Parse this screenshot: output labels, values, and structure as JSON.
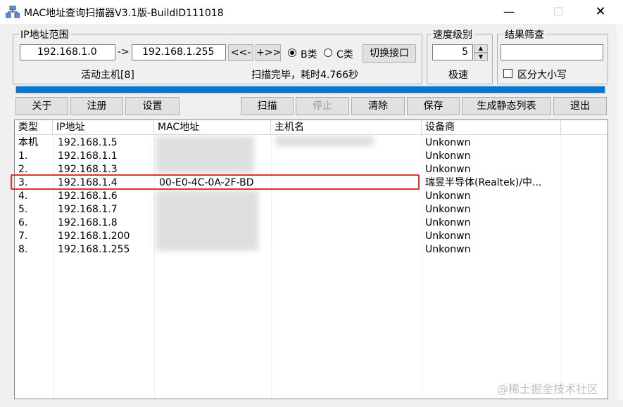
{
  "window": {
    "title": "MAC地址查询扫描器V3.1版-BuildID111018",
    "minimize": "—",
    "maximize": "☐",
    "close": "✕"
  },
  "ip_range": {
    "label": "IP地址范围",
    "start_ip": "192.168.1.0",
    "arrow": "->",
    "end_ip": "192.168.1.255",
    "prev_btn": "<<-",
    "next_btn": "+>>",
    "class_b": "B类",
    "class_c": "C类",
    "class_b_selected": true,
    "switch_btn": "切换接口",
    "active_hosts": "活动主机[8]",
    "scan_status": "扫描完毕，耗时4.766秒"
  },
  "speed": {
    "label": "速度级别",
    "value": "5",
    "level": "极速"
  },
  "filter": {
    "label": "结果筛查",
    "input_value": "",
    "case_label": "区分大小写",
    "case_checked": false
  },
  "progress": 1.0,
  "toolbar": {
    "about": "关于",
    "register": "注册",
    "settings": "设置",
    "scan": "扫描",
    "stop": "停止",
    "clear": "清除",
    "save": "保存",
    "gen_static": "生成静态列表",
    "exit": "退出"
  },
  "table": {
    "columns": [
      "类型",
      "IP地址",
      "MAC地址",
      "主机名",
      "设备商"
    ],
    "rows": [
      {
        "type": "本机",
        "ip": "192.168.1.5",
        "mac": "",
        "host": "",
        "vendor": "Unkonwn"
      },
      {
        "type": "1.",
        "ip": "192.168.1.1",
        "mac": "",
        "host": "",
        "vendor": "Unkonwn"
      },
      {
        "type": "2.",
        "ip": "192.168.1.3",
        "mac": "",
        "host": "",
        "vendor": "Unkonwn"
      },
      {
        "type": "3.",
        "ip": "192.168.1.4",
        "mac": "00-E0-4C-0A-2F-BD",
        "host": "",
        "vendor": "瑞昱半导体(Realtek)/中..."
      },
      {
        "type": "4.",
        "ip": "192.168.1.6",
        "mac": "",
        "host": "",
        "vendor": "Unkonwn"
      },
      {
        "type": "5.",
        "ip": "192.168.1.7",
        "mac": "",
        "host": "",
        "vendor": "Unkonwn"
      },
      {
        "type": "6.",
        "ip": "192.168.1.8",
        "mac": "",
        "host": "",
        "vendor": "Unkonwn"
      },
      {
        "type": "7.",
        "ip": "192.168.1.200",
        "mac": "",
        "host": "",
        "vendor": "Unkonwn"
      },
      {
        "type": "8.",
        "ip": "192.168.1.255",
        "mac": "",
        "host": "",
        "vendor": "Unkonwn"
      }
    ]
  },
  "watermark": "@稀土掘金技术社区",
  "colors": {
    "progress": "#0078d7",
    "highlight": "#e0312c"
  }
}
